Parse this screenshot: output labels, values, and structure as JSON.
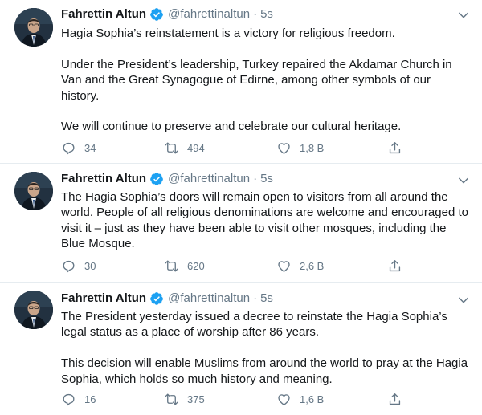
{
  "author": {
    "name": "Fahrettin Altun",
    "handle": "@fahrettinaltun",
    "separator": "·"
  },
  "icons": {
    "verified": "verified-badge-icon",
    "caret": "chevron-down-icon",
    "reply": "reply-icon",
    "retweet": "retweet-icon",
    "like": "heart-icon",
    "share": "share-icon"
  },
  "colors": {
    "verified_blue": "#1da1f2",
    "muted": "#657786",
    "divider": "#e6ecf0"
  },
  "tweets": [
    {
      "time": "5s",
      "text": "Hagia Sophia’s reinstatement is a victory for religious freedom.\n\nUnder the President’s leadership, Turkey repaired the Akdamar Church in Van and the Great Synagogue of Edirne, among other symbols of our history.\n\nWe will continue to preserve and celebrate our cultural heritage.",
      "replies": "34",
      "retweets": "494",
      "likes": "1,8 B"
    },
    {
      "time": "5s",
      "text": "The Hagia Sophia’s doors will remain open to visitors from all around the world. People of all religious denominations are welcome and encouraged to visit it – just as they have been able to visit other mosques, including the Blue Mosque.",
      "replies": "30",
      "retweets": "620",
      "likes": "2,6 B"
    },
    {
      "time": "5s",
      "text": "The President yesterday issued a decree to reinstate the Hagia Sophia’s legal status as a place of worship after 86 years.\n\nThis decision will enable Muslims from around the world to pray at the Hagia Sophia, which holds so much history and meaning.",
      "replies": "16",
      "retweets": "375",
      "likes": "1,6 B"
    }
  ]
}
